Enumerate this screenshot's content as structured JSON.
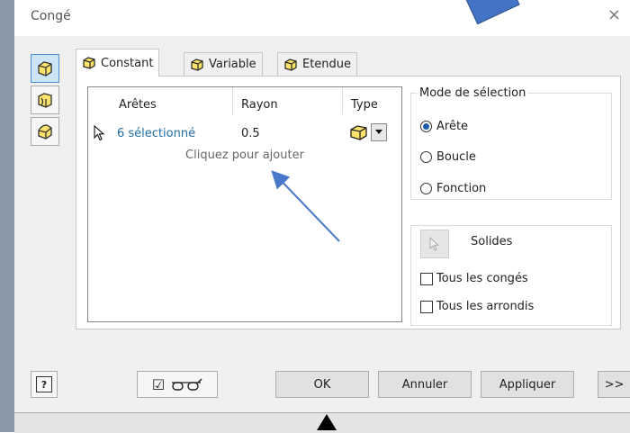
{
  "window": {
    "title": "Congé",
    "close_glyph": "×"
  },
  "tabs": [
    {
      "label": "Constant",
      "icon": "fillet-cube-icon",
      "active": true
    },
    {
      "label": "Variable",
      "icon": "fillet-cube-icon",
      "active": false
    },
    {
      "label": "Etendue",
      "icon": "fillet-cube-icon",
      "active": false
    }
  ],
  "sidebar": [
    {
      "icon": "edge-fillet-icon",
      "active": true
    },
    {
      "icon": "face-fillet-icon",
      "active": false
    },
    {
      "icon": "full-round-fillet-icon",
      "active": false
    }
  ],
  "table": {
    "columns": [
      "Arêtes",
      "Rayon",
      "Type"
    ],
    "rows": [
      {
        "edges": "6 sélectionné",
        "radius": "0.5"
      }
    ],
    "add_hint": "Cliquez pour ajouter"
  },
  "selection_mode": {
    "legend": "Mode de sélection",
    "options": [
      {
        "label": "Arête",
        "checked": true
      },
      {
        "label": "Boucle",
        "checked": false
      },
      {
        "label": "Fonction",
        "checked": false
      }
    ]
  },
  "options": {
    "solids_label": "Solides",
    "all_fillets": "Tous les congés",
    "all_rounds": "Tous les arrondis"
  },
  "footer": {
    "help": "?",
    "preview_check": "☑",
    "ok": "OK",
    "cancel": "Annuler",
    "apply": "Appliquer",
    "more": ">>"
  },
  "colors": {
    "accent": "#4472c4",
    "link": "#1f6ea8",
    "annotation_arrow": "#4a78c8"
  }
}
